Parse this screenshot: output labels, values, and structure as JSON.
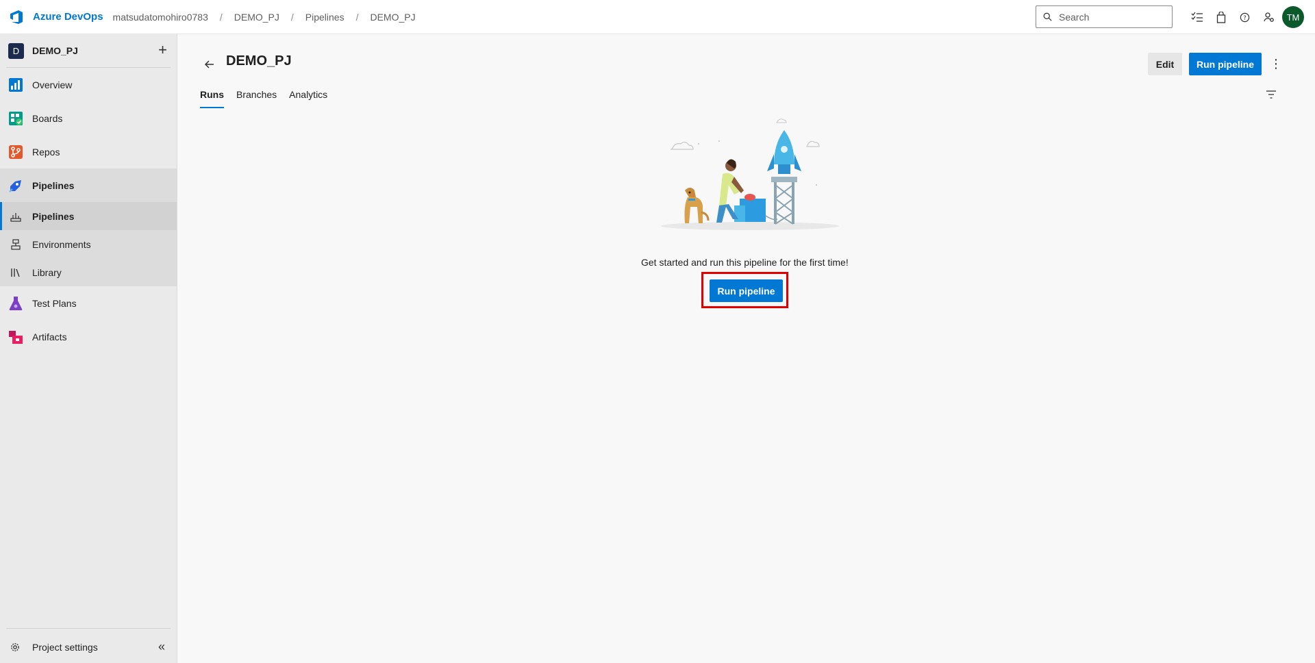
{
  "topbar": {
    "brand": "Azure DevOps",
    "breadcrumbs": [
      "matsudatomohiro0783",
      "DEMO_PJ",
      "Pipelines",
      "DEMO_PJ"
    ],
    "search_placeholder": "Search",
    "avatar_initials": "TM"
  },
  "sidebar": {
    "project_initial": "D",
    "project_name": "DEMO_PJ",
    "items": [
      {
        "label": "Overview"
      },
      {
        "label": "Boards"
      },
      {
        "label": "Repos"
      },
      {
        "label": "Pipelines"
      },
      {
        "label": "Test Plans"
      },
      {
        "label": "Artifacts"
      }
    ],
    "sub_items": [
      {
        "label": "Pipelines"
      },
      {
        "label": "Environments"
      },
      {
        "label": "Library"
      }
    ],
    "settings_label": "Project settings"
  },
  "main": {
    "title": "DEMO_PJ",
    "edit_label": "Edit",
    "run_label": "Run pipeline",
    "tabs": [
      {
        "label": "Runs"
      },
      {
        "label": "Branches"
      },
      {
        "label": "Analytics"
      }
    ],
    "empty_message": "Get started and run this pipeline for the first time!",
    "empty_button": "Run pipeline"
  },
  "colors": {
    "accent": "#0078d4",
    "highlight": "#e00000",
    "avatar_bg": "#0b5a2c"
  }
}
